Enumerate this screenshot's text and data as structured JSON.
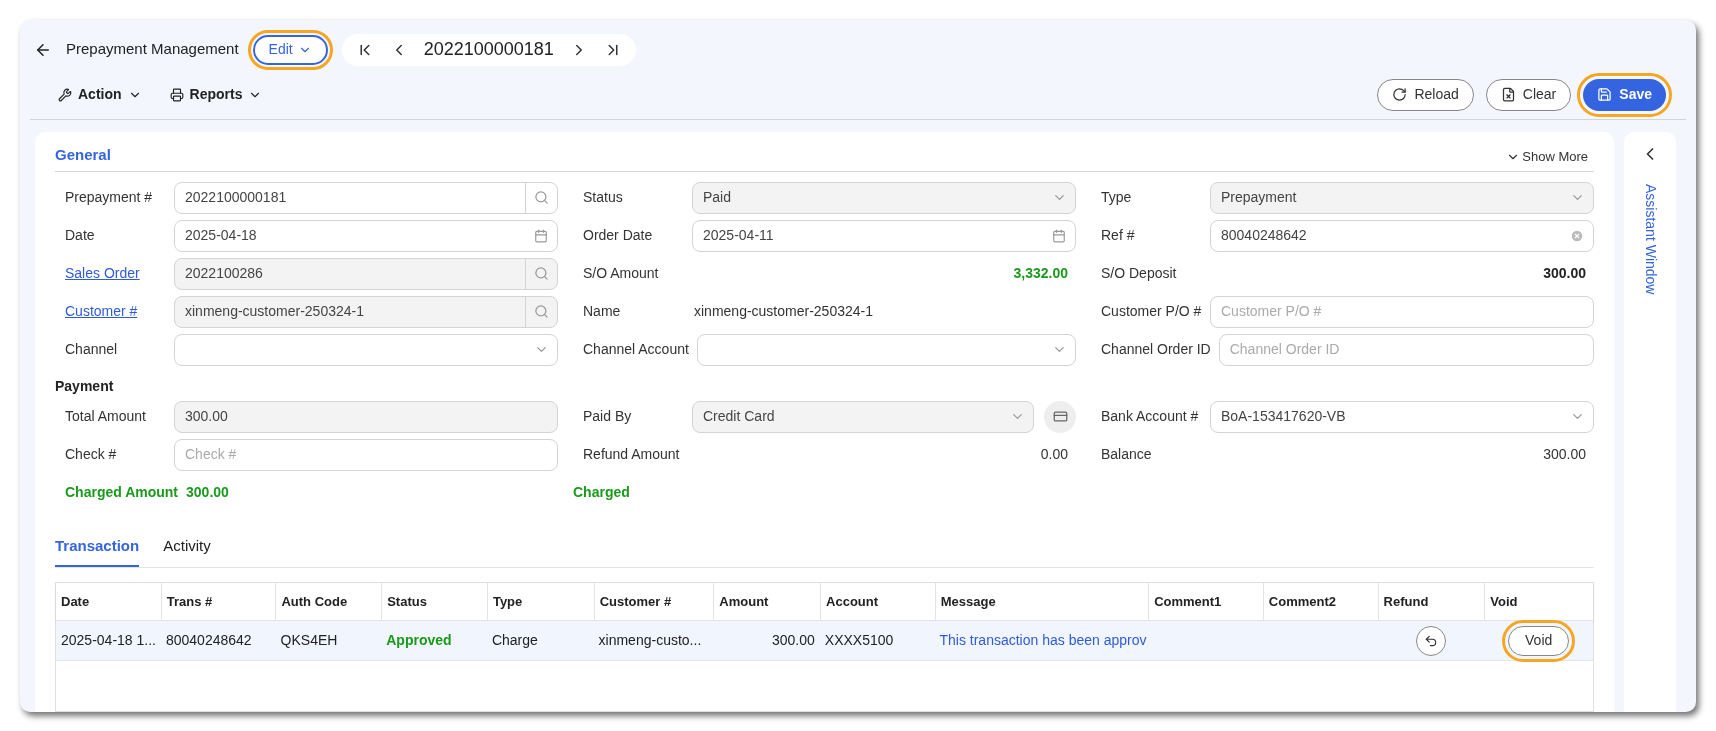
{
  "header": {
    "title": "Prepayment Management",
    "edit_button": {
      "label": "Edit",
      "highlighted": true
    },
    "record_number": "2022100000181"
  },
  "toolbar": {
    "menus": [
      {
        "label": "Action"
      },
      {
        "label": "Reports"
      }
    ],
    "buttons": [
      {
        "label": "Reload",
        "primary": false,
        "highlighted": false
      },
      {
        "label": "Clear",
        "primary": false,
        "highlighted": false
      },
      {
        "label": "Save",
        "primary": true,
        "highlighted": true
      }
    ]
  },
  "general": {
    "title": "General",
    "show_more": "Show More",
    "rows": [
      [
        {
          "label": "Prepayment #",
          "kind": "search",
          "value": "2022100000181",
          "readonly": false
        },
        {
          "label": "Status",
          "kind": "select",
          "value": "Paid",
          "readonly": true
        },
        {
          "label": "Type",
          "kind": "select",
          "value": "Prepayment",
          "readonly": true
        }
      ],
      [
        {
          "label": "Date",
          "kind": "date",
          "value": "2025-04-18",
          "readonly": false
        },
        {
          "label": "Order Date",
          "kind": "date",
          "value": "2025-04-11",
          "readonly": false
        },
        {
          "label": "Ref #",
          "kind": "clearable",
          "value": "80040248642",
          "readonly": false
        }
      ],
      [
        {
          "label": "Sales Order",
          "link": true,
          "kind": "search",
          "value": "2022100286",
          "readonly": true
        },
        {
          "label": "S/O Amount",
          "kind": "amount_green",
          "value": "3,332.00"
        },
        {
          "label": "S/O Deposit",
          "kind": "amount_bold",
          "value": "300.00"
        }
      ],
      [
        {
          "label": "Customer #",
          "link": true,
          "kind": "search",
          "value": "xinmeng-customer-250324-1",
          "readonly": true
        },
        {
          "label": "Name",
          "kind": "text",
          "value": "xinmeng-customer-250324-1"
        },
        {
          "label": "Customer P/O #",
          "kind": "input",
          "placeholder": "Customer P/O #",
          "readonly": false
        }
      ],
      [
        {
          "label": "Channel",
          "kind": "select",
          "readonly": false
        },
        {
          "label": "Channel Account",
          "kind": "select",
          "readonly": false
        },
        {
          "label": "Channel Order ID",
          "kind": "input",
          "placeholder": "Channel Order ID",
          "readonly": false
        }
      ]
    ]
  },
  "payment": {
    "title": "Payment",
    "rows": [
      [
        {
          "label": "Total Amount",
          "kind": "input",
          "value": "300.00",
          "readonly": true
        },
        {
          "label": "Paid By",
          "kind": "select",
          "value": "Credit Card",
          "readonly": true,
          "card_button": true
        },
        {
          "label": "Bank Account #",
          "kind": "select",
          "value": "BoA-153417620-VB",
          "readonly": false
        }
      ],
      [
        {
          "label": "Check #",
          "kind": "input",
          "placeholder": "Check #",
          "readonly": false
        },
        {
          "label": "Refund Amount",
          "kind": "amount",
          "value": "0.00"
        },
        {
          "label": "Balance",
          "kind": "amount",
          "value": "300.00"
        }
      ],
      [
        {
          "label": "Charged Amount",
          "kind": "charged",
          "value": "300.00"
        },
        {
          "kind": "status",
          "value": "Charged"
        }
      ]
    ]
  },
  "tabs": [
    {
      "label": "Transaction",
      "selected": true
    },
    {
      "label": "Activity",
      "selected": false
    }
  ],
  "table": {
    "columns": [
      "Date",
      "Trans #",
      "Auth Code",
      "Status",
      "Type",
      "Customer #",
      "Amount",
      "Account",
      "Message",
      "Comment1",
      "Comment2",
      "Refund",
      "Void"
    ],
    "rows": [
      {
        "selected": true,
        "cells": [
          {
            "kind": "text",
            "text": "2025-04-18 1..."
          },
          {
            "kind": "text",
            "text": "80040248642"
          },
          {
            "kind": "text",
            "text": "QKS4EH"
          },
          {
            "kind": "status",
            "text": "Approved"
          },
          {
            "kind": "text",
            "text": "Charge"
          },
          {
            "kind": "text",
            "text": "xinmeng-custo..."
          },
          {
            "kind": "amount",
            "text": "300.00"
          },
          {
            "kind": "text",
            "text": "XXXX5100"
          },
          {
            "kind": "link",
            "text": "This transaction has been approv"
          },
          {
            "kind": "empty"
          },
          {
            "kind": "empty"
          },
          {
            "kind": "refund"
          },
          {
            "kind": "void",
            "text": "Void",
            "highlighted": true
          }
        ]
      }
    ]
  },
  "assistant": {
    "label": "Assistant Window"
  }
}
